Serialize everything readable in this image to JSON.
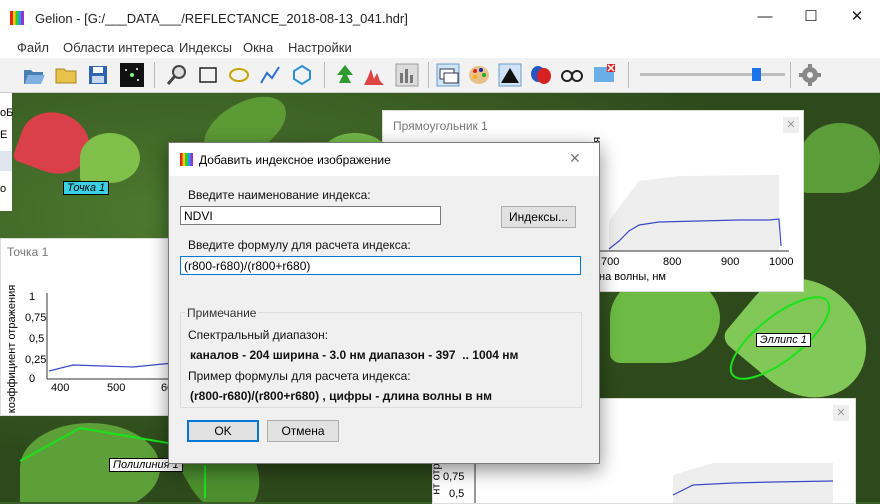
{
  "window": {
    "title": "Gelion - [G:/___DATA___/REFLECTANCE_2018-08-13_041.hdr]",
    "minimize_glyph": "—",
    "maximize_glyph": "☐",
    "close_glyph": "✕"
  },
  "menu": [
    "Файл",
    "Области интереса",
    "Индексы",
    "Окна",
    "Настройки"
  ],
  "toolbar": {
    "icons": [
      "open-folder-icon",
      "folder-icon",
      "save-icon",
      "stars-icon",
      "magnifier-icon",
      "rectangle-icon",
      "ellipse-icon",
      "polyline-icon",
      "polygon-icon",
      "leaf-icon",
      "histogram-icon",
      "bars-icon",
      "windows-icon",
      "palette-icon",
      "triangle-icon",
      "masks-icon",
      "glasses-icon",
      "screen-delete-icon",
      "gear-icon"
    ],
    "slider_value": 0.8
  },
  "annotations": {
    "point": "Точка 1",
    "ellipse": "Эллипс 1",
    "polyline": "Полилиния 1"
  },
  "panel_point": {
    "title": "Точка 1",
    "ylabel": "коэффициент отражения",
    "yticks": [
      "1",
      "0,75",
      "0,5",
      "0,25",
      "0"
    ],
    "xticks": [
      "400",
      "500",
      "60"
    ]
  },
  "panel_rect": {
    "title": "Прямоугольник 1",
    "ylabel_fragment": "ия",
    "xlabel": "на волны, нм",
    "xticks": [
      "700",
      "800",
      "900",
      "1000"
    ],
    "close_glyph": "✕"
  },
  "panel_bottom": {
    "ylabel_fragment": "нт отр",
    "yticks": [
      "0,75",
      "0,5"
    ],
    "close_glyph": "✕"
  },
  "dialog": {
    "title": "Добавить индексное изображение",
    "close_glyph": "✕",
    "name_label": "Введите наименование индекса:",
    "name_value": "NDVI",
    "indexes_button": "Индексы...",
    "formula_label": "Введите формулу для расчета индекса:",
    "formula_value": "(r800-r680)/(r800+r680)",
    "note_title": "Примечание",
    "range_label": "Спектральный диапазон:",
    "range_value": "каналов - 204 ширина - 3.0 нм диапазон - 397  .. 1004 нм",
    "example_label": "Пример формулы для расчета индекса:",
    "example_value": "(r800-r680)/(r800+r680) , цифры - длина волны в нм",
    "ok_button": "OK",
    "cancel_button": "Отмена"
  },
  "left_fragment": {
    "lines": [
      "оБ",
      "Е",
      "11",
      "о"
    ]
  }
}
